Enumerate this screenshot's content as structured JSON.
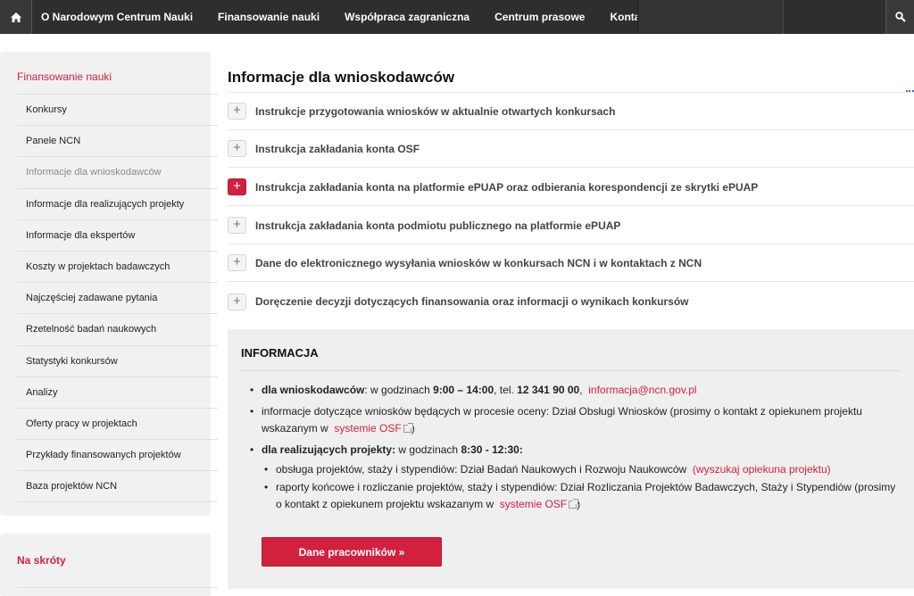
{
  "topnav": {
    "items": [
      "O Narodowym Centrum Nauki",
      "Finansowanie nauki",
      "Współpraca zagraniczna",
      "Centrum prasowe",
      "Kontakt"
    ]
  },
  "sidebar": {
    "heading": "Finansowanie nauki",
    "items": [
      "Konkursy",
      "Panele NCN",
      "Informacje dla wnioskodawców",
      "Informacje dla realizujących projekty",
      "Informacje dla ekspertów",
      "Koszty w projektach badawczych",
      "Najczęściej zadawane pytania",
      "Rzetelność badań naukowych",
      "Statystyki konkursów",
      "Analizy",
      "Oferty pracy w projektach",
      "Przykłady finansowanych projektów",
      "Baza projektów NCN"
    ],
    "active_index": 2,
    "shortcuts_heading": "Na skróty"
  },
  "main": {
    "title": "Informacje dla wnioskodawców",
    "accordion": [
      {
        "label": "Instrukcje przygotowania wniosków w aktualnie otwartych konkursach",
        "highlighted": false
      },
      {
        "label": "Instrukcja zakładania konta OSF",
        "highlighted": false
      },
      {
        "label": "Instrukcja zakładania konta na platformie ePUAP oraz odbierania korespondencji ze skrytki ePUAP",
        "highlighted": true
      },
      {
        "label": "Instrukcja zakładania konta podmiotu publicznego na platformie ePUAP",
        "highlighted": false
      },
      {
        "label": "Dane do elektronicznego wysyłania wniosków w konkursach NCN i w kontaktach z NCN",
        "highlighted": false
      },
      {
        "label": "Doręczenie decyzji dotyczących finansowania oraz informacji o wynikach konkursów",
        "highlighted": false
      }
    ],
    "accordion_symbol": "+"
  },
  "info": {
    "title": "INFORMACJA",
    "b1_bold": "dla wnioskodawców",
    "b1_text1": ": w godzinach ",
    "b1_hours": "9:00 – 14:00",
    "b1_text2": ", tel. ",
    "b1_phone": "12 341 90 00",
    "b1_text3": ",",
    "b1_email": "informacja@ncn.gov.pl",
    "b2_text1": "informacje dotyczące wniosków będących w procesie oceny: Dział Obsługi Wniosków (prosimy o kontakt z opiekunem projektu wskazanym w",
    "b2_link": "systemie OSF",
    "b2_text2": ")",
    "b3_bold": "dla realizujących projekty:",
    "b3_text1": " w godzinach ",
    "b3_hours": "8:30 - 12:30:",
    "s1_text": "obsługa projektów, staży i stypendiów: Dział Badań Naukowych i Rozwoju Naukowców",
    "s1_link": "(wyszukaj opiekuna projektu)",
    "s2_text1": "raporty końcowe i rozliczanie projektów, staży i stypendiów: Dział Rozliczania Projektów Badawczych, Staży i Stypendiów (prosimy o kontakt z opiekunem projektu wskazanym w",
    "s2_link": "systemie OSF",
    "s2_text2": ")",
    "button_label": "Dane pracowników »"
  },
  "colors": {
    "accent": "#d2213f",
    "nav_bg": "#2e2e2e",
    "panel_bg": "#efefef"
  }
}
